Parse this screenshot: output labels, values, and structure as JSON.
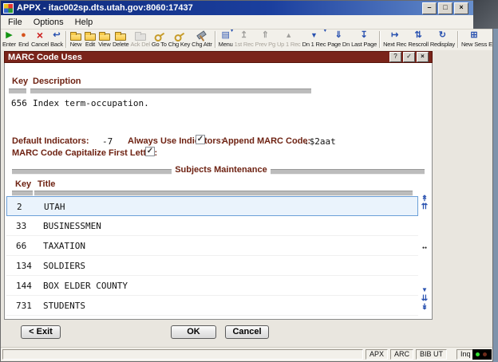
{
  "window": {
    "title": "APPX - itac002sp.dts.utah.gov:8060:17437"
  },
  "menu": {
    "items": [
      {
        "label": "File"
      },
      {
        "label": "Options"
      },
      {
        "label": "Help"
      }
    ]
  },
  "toolbar": {
    "buttons": [
      {
        "label": "Enter",
        "icon": "enter"
      },
      {
        "label": "End",
        "icon": "end"
      },
      {
        "label": "Cancel",
        "icon": "cancel"
      },
      {
        "label": "Back",
        "icon": "back"
      },
      {
        "sep": true
      },
      {
        "label": "New",
        "icon": "new"
      },
      {
        "label": "Edit",
        "icon": "edit"
      },
      {
        "label": "View",
        "icon": "view"
      },
      {
        "label": "Delete",
        "icon": "delete"
      },
      {
        "label": "Ack Del",
        "icon": "ackdel",
        "enabled": false
      },
      {
        "label": "Go To",
        "icon": "goto"
      },
      {
        "label": "Chg Key",
        "icon": "chgkey"
      },
      {
        "label": "Chg Attr",
        "icon": "chgattr"
      },
      {
        "sep": true
      },
      {
        "label": "Menu",
        "icon": "menu",
        "dropdown": true
      },
      {
        "label": "1st Rec",
        "icon": "firstrec",
        "enabled": false
      },
      {
        "label": "Prev Pg",
        "icon": "prevpg",
        "enabled": false
      },
      {
        "label": "Up 1 Rec",
        "icon": "up1rec",
        "enabled": false
      },
      {
        "label": "Dn 1 Rec",
        "icon": "dn1rec",
        "dropdown": true
      },
      {
        "label": "Page Dn",
        "icon": "pagedn"
      },
      {
        "label": "Last Page",
        "icon": "lastpage"
      },
      {
        "sep": true
      },
      {
        "label": "Next Rec",
        "icon": "nextrec"
      },
      {
        "label": "Rescroll",
        "icon": "rescroll"
      },
      {
        "label": "Redisplay",
        "icon": "redisplay"
      },
      {
        "sep": true
      },
      {
        "label": "New Sess",
        "icon": "newsess"
      },
      {
        "label": "End Sess",
        "icon": "endsess"
      }
    ]
  },
  "form": {
    "title": "MARC Code Uses",
    "record_header": {
      "key": "Key",
      "description": "Description"
    },
    "record": {
      "key": "656",
      "description": "Index term-occupation."
    },
    "fields": {
      "default_indicators_label": "Default Indicators:",
      "default_indicators_value": "-7",
      "always_use_indicators_label": "Always Use Indicators:",
      "always_use_indicators_checked": true,
      "append_marc_code_label": "Append MARC Code:",
      "append_marc_code_value": ".$2aat",
      "capitalize_label": "MARC Code Capitalize First Letter:",
      "capitalize_checked": true
    },
    "subjects": {
      "section_title": "Subjects Maintenance",
      "key_label": "Key",
      "title_label": "Title",
      "rows": [
        {
          "key": "2",
          "title": "UTAH",
          "selected": true
        },
        {
          "key": "33",
          "title": "BUSINESSMEN"
        },
        {
          "key": "66",
          "title": "TAXATION"
        },
        {
          "key": "134",
          "title": "SOLDIERS"
        },
        {
          "key": "144",
          "title": "BOX ELDER COUNTY"
        },
        {
          "key": "731",
          "title": "STUDENTS"
        }
      ]
    },
    "actions": {
      "exit": "< Exit",
      "ok": "OK",
      "cancel": "Cancel"
    }
  },
  "statusbar": {
    "panels": [
      {
        "label": "APX"
      },
      {
        "label": "ARC"
      },
      {
        "label": "BIB UT"
      },
      {
        "label": "Inq"
      }
    ]
  },
  "colors": {
    "desktop_bg": "#7e93ab",
    "form_title_bg": "#7a241a",
    "label_text": "#6e2212",
    "selected_row_bg": "#eaf3fc",
    "selected_row_border": "#6b9fd8",
    "nav_icon_blue": "#2a52b0"
  }
}
